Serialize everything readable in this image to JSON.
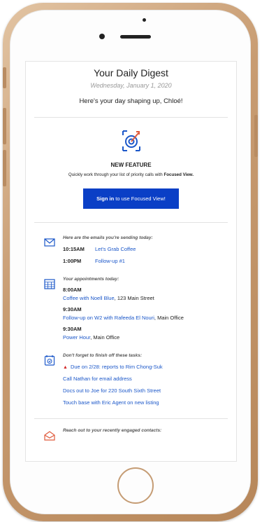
{
  "header": {
    "title": "Your Daily Digest",
    "date": "Wednesday, January 1, 2020",
    "greeting": "Here's your day shaping up, Chloé!"
  },
  "feature": {
    "icon": "target-icon",
    "label": "NEW FEATURE",
    "desc_prefix": "Quickly work through your list of priority calls with ",
    "desc_bold": "Focused View.",
    "button_bold": "Sign in",
    "button_rest": " to use Focused View!",
    "button_color": "#0a3fc6"
  },
  "emails": {
    "icon": "envelope-icon",
    "heading": "Here are the emails you're sending today:",
    "items": [
      {
        "time": "10:15AM",
        "subject": "Let's Grab Coffee"
      },
      {
        "time": "1:00PM",
        "subject": "Follow-up #1"
      }
    ]
  },
  "appointments": {
    "icon": "calendar-icon",
    "heading": "Your appointments today:",
    "items": [
      {
        "time": "8:00AM",
        "title": "Coffee with Noell Blue",
        "location": ", 123 Main Street"
      },
      {
        "time": "9:30AM",
        "title": "Follow-up on W2 with Rafeeda El Nouri",
        "location": ", Main Office"
      },
      {
        "time": "9:30AM",
        "title": "Power Hour",
        "location": ", Main Office"
      }
    ]
  },
  "tasks": {
    "icon": "checklist-icon",
    "heading": "Don't forget to finish off these tasks:",
    "items": [
      {
        "text": "Due on 2/28: reports to Rim Chong-Suk",
        "overdue": true
      },
      {
        "text": "Call Nathan for email address",
        "overdue": false
      },
      {
        "text": "Docs out to Joe for 220 South Sixth Street",
        "overdue": false
      },
      {
        "text": "Touch base with Eric Agent on new listing",
        "overdue": false
      }
    ]
  },
  "contacts": {
    "icon": "open-envelope-icon",
    "heading": "Reach out to your recently engaged contacts:"
  },
  "colors": {
    "link": "#1b57c9",
    "warning": "#d32727",
    "frame": "#c89c72"
  }
}
